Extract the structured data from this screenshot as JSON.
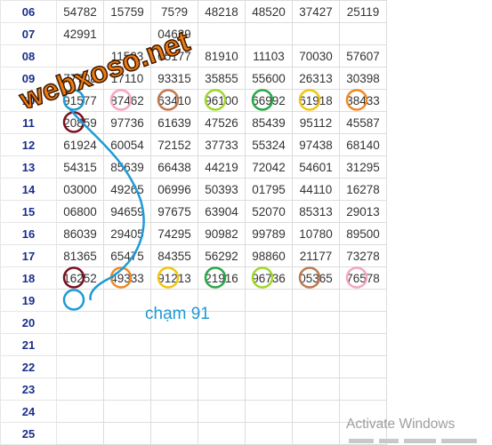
{
  "sheet": {
    "rows": [
      {
        "label": "06",
        "values": [
          "54782",
          "15759",
          "75?9",
          "48218",
          "48520",
          "37427",
          "25119"
        ]
      },
      {
        "label": "07",
        "values": [
          "42991",
          "",
          "04629",
          "",
          "",
          "",
          ""
        ]
      },
      {
        "label": "08",
        "values": [
          "",
          "11503",
          "05177",
          "81910",
          "11103",
          "70030",
          "57607"
        ]
      },
      {
        "label": "09",
        "values": [
          "77708",
          "17110",
          "93315",
          "35855",
          "55600",
          "26313",
          "30398"
        ]
      },
      {
        "label": "10",
        "values": [
          "91577",
          "87462",
          "63410",
          "96100",
          "66992",
          "61918",
          "38433"
        ]
      },
      {
        "label": "11",
        "values": [
          "20859",
          "97736",
          "61639",
          "47526",
          "85439",
          "95112",
          "45587"
        ]
      },
      {
        "label": "12",
        "values": [
          "61924",
          "60054",
          "72152",
          "37733",
          "55324",
          "97438",
          "68140"
        ]
      },
      {
        "label": "13",
        "values": [
          "54315",
          "85639",
          "66438",
          "44219",
          "72042",
          "54601",
          "31295"
        ]
      },
      {
        "label": "14",
        "values": [
          "03000",
          "49265",
          "06996",
          "50393",
          "01795",
          "44110",
          "16278"
        ]
      },
      {
        "label": "15",
        "values": [
          "06800",
          "94659",
          "97675",
          "63904",
          "52070",
          "85313",
          "29013"
        ]
      },
      {
        "label": "16",
        "values": [
          "86039",
          "29405",
          "74295",
          "90982",
          "99789",
          "10780",
          "89500"
        ]
      },
      {
        "label": "17",
        "values": [
          "81365",
          "65475",
          "84355",
          "56292",
          "98860",
          "21177",
          "73278"
        ]
      },
      {
        "label": "18",
        "values": [
          "16252",
          "49333",
          "91213",
          "21916",
          "96736",
          "05365",
          "76578"
        ]
      },
      {
        "label": "19",
        "values": [
          "",
          "",
          "",
          "",
          "",
          "",
          ""
        ]
      },
      {
        "label": "20",
        "values": [
          "",
          "",
          "",
          "",
          "",
          "",
          ""
        ]
      },
      {
        "label": "21",
        "values": [
          "",
          "",
          "",
          "",
          "",
          "",
          ""
        ]
      },
      {
        "label": "22",
        "values": [
          "",
          "",
          "",
          "",
          "",
          "",
          ""
        ]
      },
      {
        "label": "23",
        "values": [
          "",
          "",
          "",
          "",
          "",
          "",
          ""
        ]
      },
      {
        "label": "24",
        "values": [
          "",
          "",
          "",
          "",
          "",
          "",
          ""
        ]
      },
      {
        "label": "25",
        "values": [
          "",
          "",
          "",
          "",
          "",
          "",
          ""
        ]
      }
    ]
  },
  "watermark": {
    "text": "webxoso.net"
  },
  "annotation": {
    "text": "chạm 91"
  },
  "system_notice": {
    "text": "Activate Windows"
  },
  "circle_marks": [
    {
      "row": "10",
      "col": 1,
      "color": "#1e9ad6"
    },
    {
      "row": "10",
      "col": 2,
      "color": "#f4a6c0"
    },
    {
      "row": "10",
      "col": 3,
      "color": "#c07850"
    },
    {
      "row": "10",
      "col": 4,
      "color": "#9ed82a"
    },
    {
      "row": "10",
      "col": 5,
      "color": "#2aa84a"
    },
    {
      "row": "10",
      "col": 6,
      "color": "#f2c512"
    },
    {
      "row": "10",
      "col": 7,
      "color": "#ee8a28"
    },
    {
      "row": "11",
      "col": 1,
      "color": "#7a1020"
    },
    {
      "row": "18",
      "col": 1,
      "color": "#7a1020"
    },
    {
      "row": "18",
      "col": 2,
      "color": "#ee8a28"
    },
    {
      "row": "18",
      "col": 3,
      "color": "#f2c512"
    },
    {
      "row": "18",
      "col": 4,
      "color": "#2aa84a"
    },
    {
      "row": "18",
      "col": 5,
      "color": "#9ed82a"
    },
    {
      "row": "18",
      "col": 6,
      "color": "#c07850"
    },
    {
      "row": "18",
      "col": 7,
      "color": "#f4a6c0"
    },
    {
      "row": "19",
      "col": 1,
      "color": "#1e9ad6"
    }
  ],
  "colors": {
    "accent_line": "#1e9ad6",
    "row_label": "#1a2e8c",
    "watermark_fill": "#ee7a12"
  }
}
